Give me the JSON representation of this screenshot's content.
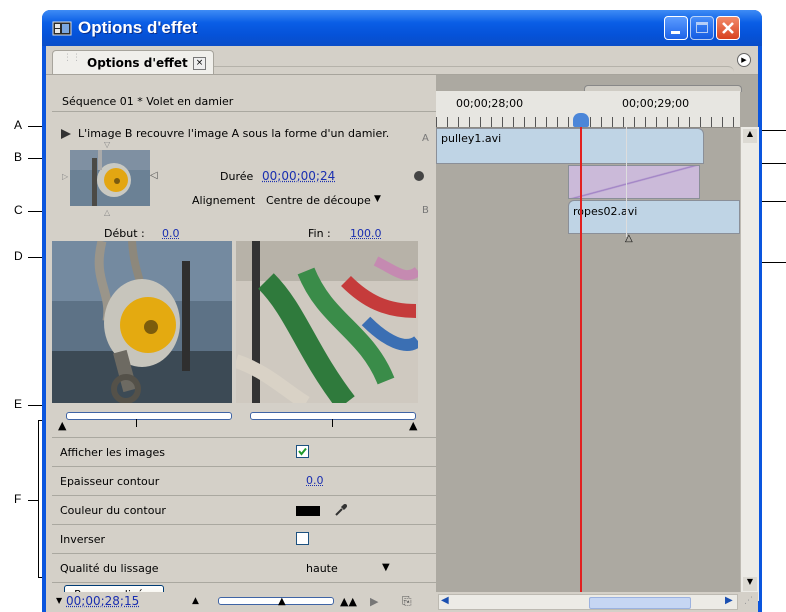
{
  "window": {
    "title": "Options d'effet",
    "tab_label": "Options d'effet",
    "tab_close_glyph": "×"
  },
  "effect": {
    "sequence_label": "Séquence 01 * Volet en damier",
    "description": "L'image B recouvre l'image A sous la forme d'un damier.",
    "duration_label": "Durée",
    "duration_value": "00;00;00;24",
    "alignment_label": "Alignement",
    "alignment_value": "Centre de découpe",
    "track_a": "A",
    "track_b": "B",
    "start_label": "Début :",
    "start_value": "0.0",
    "end_label": "Fin :",
    "end_value": "100.0"
  },
  "properties": [
    {
      "label": "Afficher les images",
      "type": "checkbox",
      "checked": true
    },
    {
      "label": "Epaisseur contour",
      "type": "value",
      "value": "0.0"
    },
    {
      "label": "Couleur du contour",
      "type": "color",
      "color": "#000000"
    },
    {
      "label": "Inverser",
      "type": "checkbox",
      "checked": false
    },
    {
      "label": "Qualité du lissage",
      "type": "dropdown",
      "value": "haute"
    }
  ],
  "custom_button": "Personnalisé...",
  "timecode": "00;00;28;15",
  "timeline": {
    "ruler_left": "00;00;28;00",
    "ruler_right": "00;00;29;00",
    "clip_a": "pulley1.avi",
    "clip_b": "ropes02.avi"
  },
  "callouts_left": [
    "A",
    "B",
    "C",
    "D",
    "E",
    "F"
  ],
  "icons": {
    "app": "premiere-app-icon",
    "panel_menu": "panel-menu-icon",
    "eyedropper": "eyedropper-icon",
    "play": "play-triangle-icon"
  },
  "colors": {
    "titlebar": "#0a55de",
    "panel_bg": "#d4d0c8",
    "timeline_bg": "#aca9a1",
    "clip_blue": "#bcd3e6",
    "transition_purple": "#c7b6d8",
    "playhead": "#e22020",
    "link_blue": "#1a2fb0"
  }
}
